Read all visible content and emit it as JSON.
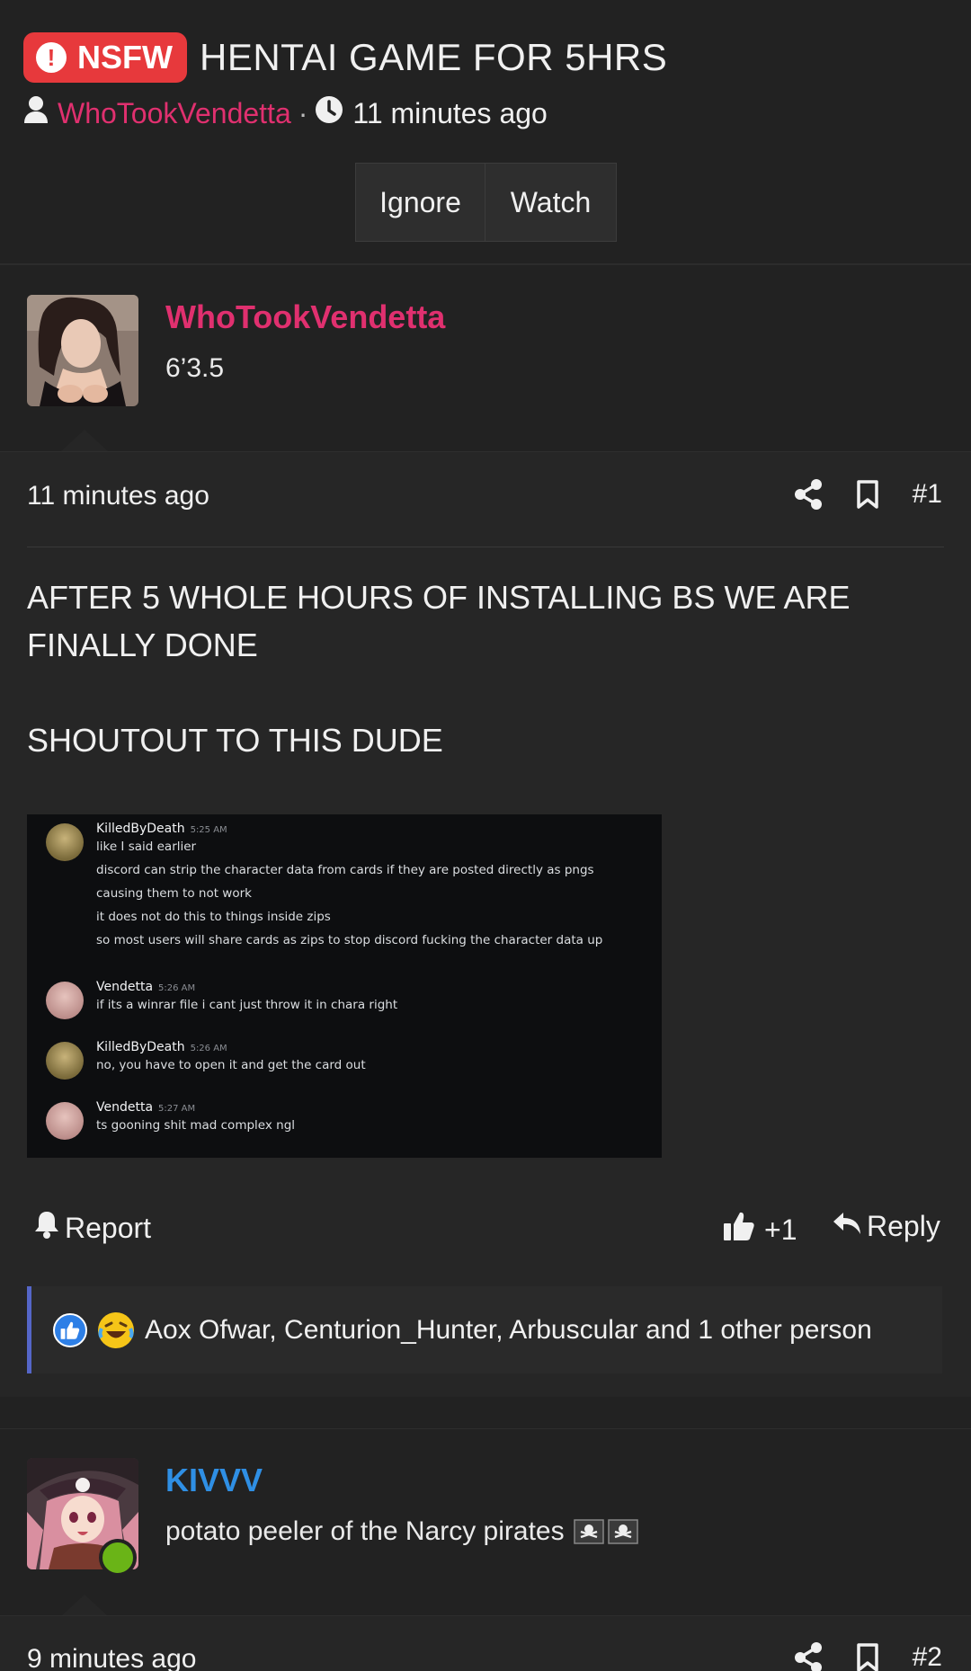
{
  "thread": {
    "nsfw_label": "NSFW",
    "title": "HENTAI GAME FOR 5HRS",
    "author": "WhoTookVendetta",
    "separator": "·",
    "time": "11 minutes ago",
    "ignore_label": "Ignore",
    "watch_label": "Watch"
  },
  "posts": [
    {
      "username": "WhoTookVendetta",
      "username_color": "#e0306f",
      "user_title": "6’3.5",
      "time": "11 minutes ago",
      "number": "#1",
      "message_lines": [
        "AFTER 5 WHOLE HOURS OF INSTALLING BS WE ARE",
        "FINALLY DONE",
        "SHOUTOUT TO THIS DUDE"
      ],
      "embed": [
        {
          "name": "KilledByDeath",
          "ts": "5:25 AM",
          "lines": [
            "like I said earlier",
            "discord can strip the character data from cards if they are posted directly as pngs",
            "causing them to not work",
            "it does not do this to things inside zips",
            "so most users will share cards as zips to stop discord fucking the character data up"
          ]
        },
        {
          "name": "Vendetta",
          "ts": "5:26 AM",
          "lines": [
            "if its a winrar file i cant just throw it in chara right"
          ]
        },
        {
          "name": "KilledByDeath",
          "ts": "5:26 AM",
          "lines": [
            "no, you have to open it and get the card out"
          ]
        },
        {
          "name": "Vendetta",
          "ts": "5:27 AM",
          "lines": [
            "ts gooning shit mad complex ngl"
          ]
        }
      ],
      "report_label": "Report",
      "like_count": "+1",
      "reply_label": "Reply",
      "reactions_text": "Aox Ofwar, Centurion_Hunter, Arbuscular and 1 other person"
    },
    {
      "username": "KIVVV",
      "username_color": "#2f8fe4",
      "user_title": "potato peeler of the Narcy pirates",
      "user_title_emoji": "🏴‍☠️🏴‍☠️",
      "time": "9 minutes ago",
      "number": "#2"
    }
  ],
  "icons": [
    "alert-icon",
    "user-icon",
    "clock-icon",
    "share-icon",
    "bookmark-icon",
    "bell-icon",
    "thumbs-up-icon",
    "reply-icon",
    "like-reaction-icon",
    "laugh-reaction-icon",
    "online-status-icon"
  ],
  "colors": {
    "background": "#222222",
    "post_background": "#262626",
    "nsfw": "#e7393c",
    "author_pink": "#e0306f",
    "author_blue": "#2f8fe4",
    "online": "#6ab417",
    "reaction_bar": "#5566c8"
  }
}
